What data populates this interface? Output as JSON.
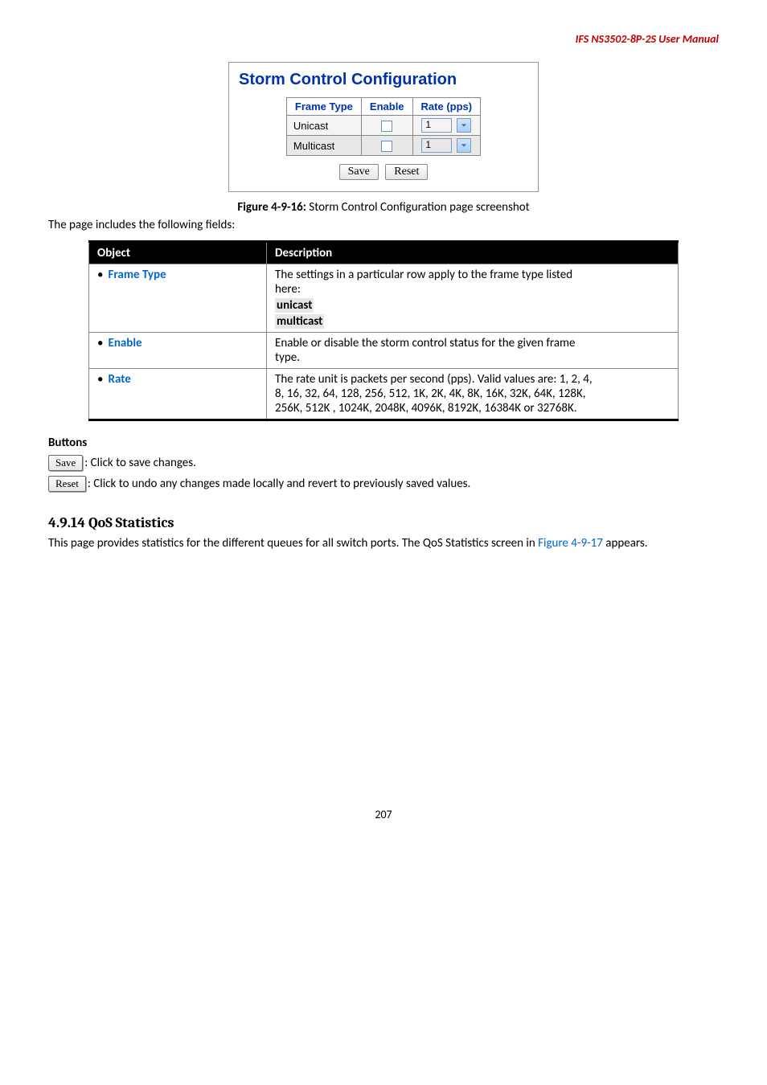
{
  "header": {
    "product": "IFS NS3502-8P-2S  User  Manual"
  },
  "figure": {
    "title": "Storm Control Configuration",
    "headers": {
      "frame_type": "Frame Type",
      "enable": "Enable",
      "rate": "Rate (pps)"
    },
    "rows": [
      {
        "name": "Unicast",
        "rate": "1"
      },
      {
        "name": "Multicast",
        "rate": "1"
      }
    ],
    "save": "Save",
    "reset": "Reset"
  },
  "caption": {
    "label": "Figure 4-9-16:",
    "text": " Storm Control Configuration page screenshot"
  },
  "intro": "The page includes the following fields:",
  "desc_table": {
    "head_object": "Object",
    "head_desc": "Description",
    "rows": [
      {
        "obj": "Frame Type",
        "lines": [
          "The settings in a particular row apply to the frame type listed",
          "here:"
        ],
        "bold_lines": [
          "unicast",
          "multicast"
        ]
      },
      {
        "obj": "Enable",
        "lines": [
          "Enable or disable the storm control status for the given frame",
          "type."
        ],
        "bold_lines": []
      },
      {
        "obj": "Rate",
        "lines": [
          "The rate unit is packets per second (pps). Valid values are: 1, 2, 4,",
          "8, 16, 32, 64, 128, 256, 512, 1K, 2K, 4K, 8K, 16K, 32K, 64K, 128K,",
          "256K, 512K , 1024K, 2048K, 4096K, 8192K, 16384K or 32768K."
        ],
        "bold_lines": []
      }
    ]
  },
  "buttons_section": {
    "heading": "Buttons",
    "save_btn": "Save",
    "save_text": ": Click to save changes.",
    "reset_btn": "Reset",
    "reset_text": ": Click to undo any changes made locally and revert to previously saved values."
  },
  "section": {
    "number": "4.9.14 QoS Statistics",
    "para_pre": "This page provides statistics for the different queues for all switch ports. The QoS Statistics screen in ",
    "link": "Figure 4-9-17",
    "para_post": " appears."
  },
  "page_number": "207"
}
